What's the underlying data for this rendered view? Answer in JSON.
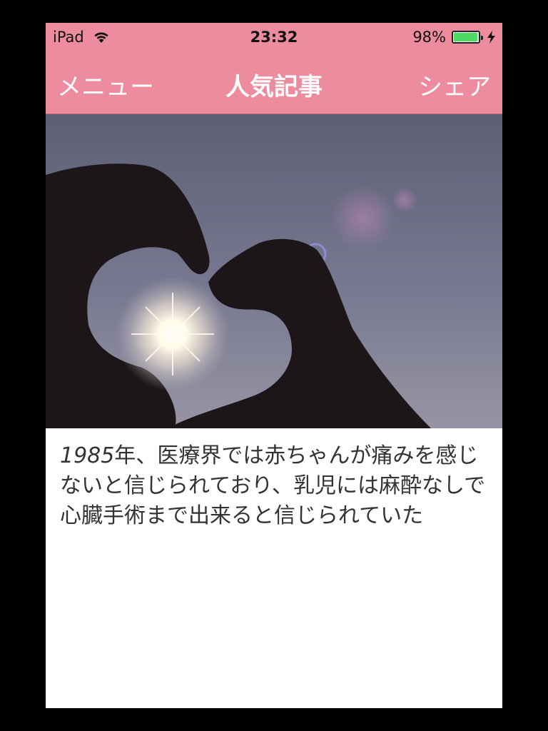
{
  "status_bar": {
    "device": "iPad",
    "time": "23:32",
    "battery_text": "98%",
    "battery_level": 0.98,
    "battery_color": "#4cd964"
  },
  "nav": {
    "left_label": "メニュー",
    "title": "人気記事",
    "right_label": "シェア",
    "background": "#ee8c9f"
  },
  "article": {
    "year": "1985",
    "text": "年、医療界では赤ちゃんが痛みを感じないと信じられており、乳児には麻酔なしで心臓手術まで出来ると信じられていた"
  },
  "icons": {
    "wifi": "wifi-icon",
    "battery": "battery-icon",
    "charging": "bolt-icon"
  }
}
